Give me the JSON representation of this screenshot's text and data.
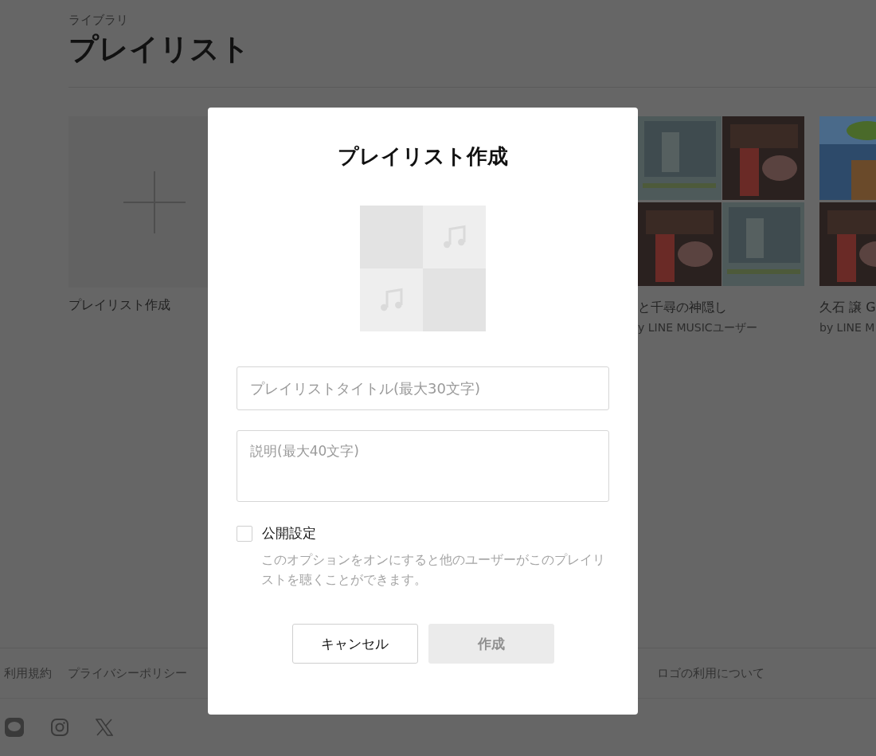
{
  "header": {
    "breadcrumb": "ライブラリ",
    "title": "プレイリスト"
  },
  "playlists": [
    {
      "kind": "create",
      "title": "プレイリスト作成"
    },
    {
      "kind": "playlist",
      "title": "と千尋の神隠し",
      "owner": "y LINE MUSICユーザー"
    },
    {
      "kind": "playlist",
      "title": "久石 譲 G",
      "owner": "by LINE M"
    }
  ],
  "footer": {
    "links_left": [
      "利用規約",
      "プライバシーポリシー"
    ],
    "links_right": [
      "ロゴの利用について"
    ]
  },
  "dialog": {
    "title": "プレイリスト作成",
    "title_field": {
      "placeholder": "プレイリストタイトル(最大30文字)"
    },
    "description_field": {
      "placeholder": "説明(最大40文字)"
    },
    "public": {
      "label": "公開設定",
      "checked": false,
      "note": "このオプションをオンにすると他のユーザーがこのプレイリストを聴くことができます。"
    },
    "buttons": [
      {
        "label": "キャンセル",
        "kind": "secondary",
        "disabled": false
      },
      {
        "label": "作成",
        "kind": "primary",
        "disabled": true
      }
    ]
  }
}
